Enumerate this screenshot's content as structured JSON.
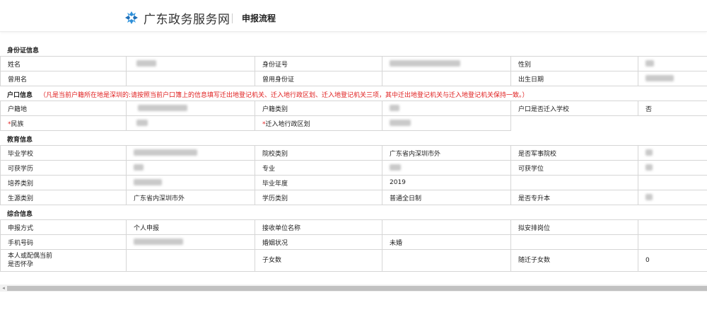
{
  "header": {
    "brand": "广东政务服务网",
    "subtitle": "申报流程",
    "logo_color": "#2e8fd8"
  },
  "sections": {
    "id": {
      "title": "身份证信息",
      "labels": [
        "姓名",
        "身份证号",
        "性别",
        "曾用名",
        "曾用身份证",
        "出生日期"
      ]
    },
    "hukou": {
      "title": "户口信息",
      "note": "（凡是当前户籍所在地是深圳的:请按照当前户口簿上的信息填写迁出地登记机关、迁入地行政区划、迁入地登记机关三项，其中迁出地登记机关与迁入地登记机关保持一致。）",
      "labels": [
        "户籍地",
        "户籍类别",
        "户口是否迁入学校",
        "民族",
        "迁入地行政区划"
      ],
      "values": {
        "move_to_school": "否"
      }
    },
    "edu": {
      "title": "教育信息",
      "labels": [
        "毕业学校",
        "院校类别",
        "是否军事院校",
        "可获学历",
        "专业",
        "可获学位",
        "培养类别",
        "毕业年度",
        "生源类别",
        "学历类别",
        "是否专升本"
      ],
      "values": {
        "school_type": "广东省内深圳市外",
        "grad_year": "2019",
        "origin_type": "广东省内深圳市外",
        "edu_type": "普通全日制"
      }
    },
    "general": {
      "title": "综合信息",
      "labels": [
        "申报方式",
        "接收单位名称",
        "拟安排岗位",
        "手机号码",
        "婚姻状况",
        "本人或配偶当前",
        "是否怀孕",
        "子女数",
        "随迁子女数"
      ],
      "values": {
        "apply_method": "个人申报",
        "marital": "未婚",
        "children_moving": "0"
      }
    }
  }
}
